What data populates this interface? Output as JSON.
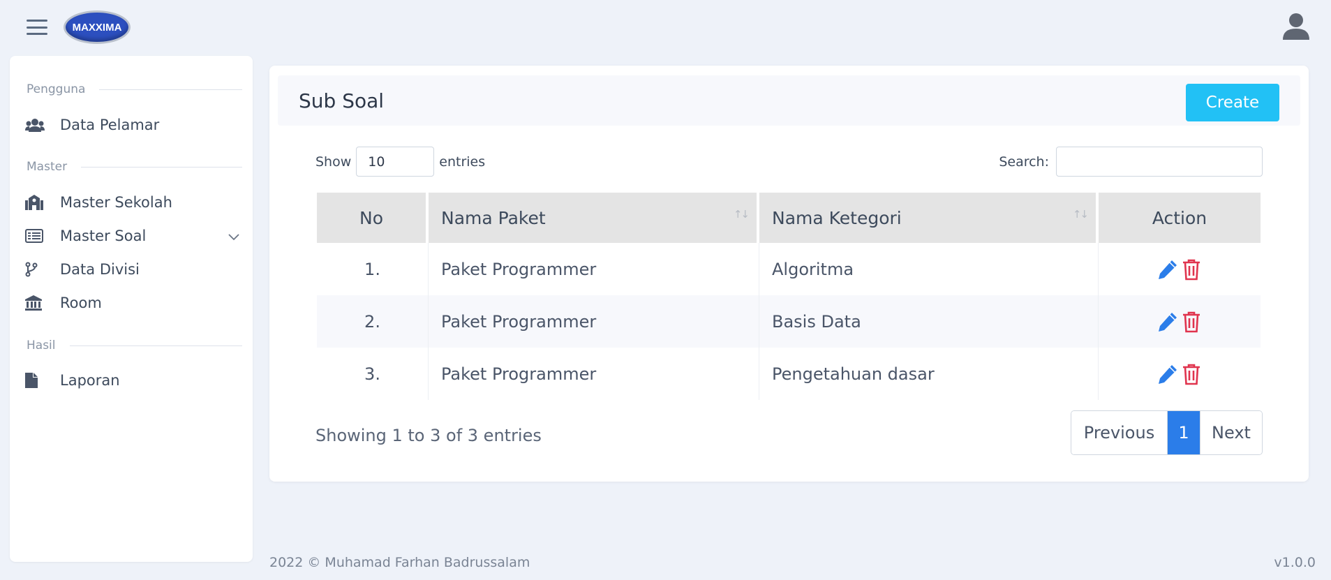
{
  "app": {
    "logo_text": "MAXXIMA"
  },
  "sidebar": {
    "sections": [
      {
        "label": "Pengguna"
      },
      {
        "label": "Master"
      },
      {
        "label": "Hasil"
      }
    ],
    "items": [
      {
        "label": "Data Pelamar",
        "icon": "users-icon"
      },
      {
        "label": "Master Sekolah",
        "icon": "school-icon"
      },
      {
        "label": "Master Soal",
        "icon": "list-icon"
      },
      {
        "label": "Data Divisi",
        "icon": "code-branch-icon"
      },
      {
        "label": "Room",
        "icon": "building-columns-icon"
      },
      {
        "label": "Laporan",
        "icon": "file-icon"
      }
    ]
  },
  "page": {
    "title": "Sub Soal",
    "create_label": "Create",
    "show_label": "Show",
    "show_value": "10",
    "entries_label": "entries",
    "search_label": "Search:",
    "search_value": ""
  },
  "table": {
    "headers": [
      "No",
      "Nama Paket",
      "Nama Ketegori",
      "Action"
    ],
    "rows": [
      {
        "no": "1.",
        "paket": "Paket Programmer",
        "kategori": "Algoritma"
      },
      {
        "no": "2.",
        "paket": "Paket Programmer",
        "kategori": "Basis Data"
      },
      {
        "no": "3.",
        "paket": "Paket Programmer",
        "kategori": "Pengetahuan dasar"
      }
    ],
    "info": "Showing 1 to 3 of 3 entries",
    "pagination": {
      "previous": "Previous",
      "current": "1",
      "next": "Next"
    }
  },
  "footer": {
    "copyright": "2022 © Muhamad Farhan Badrussalam",
    "version": "v1.0.0"
  },
  "colors": {
    "accent": "#2b7de9",
    "create": "#22c1f5",
    "delete": "#e0344e",
    "edit": "#2b7de9"
  }
}
